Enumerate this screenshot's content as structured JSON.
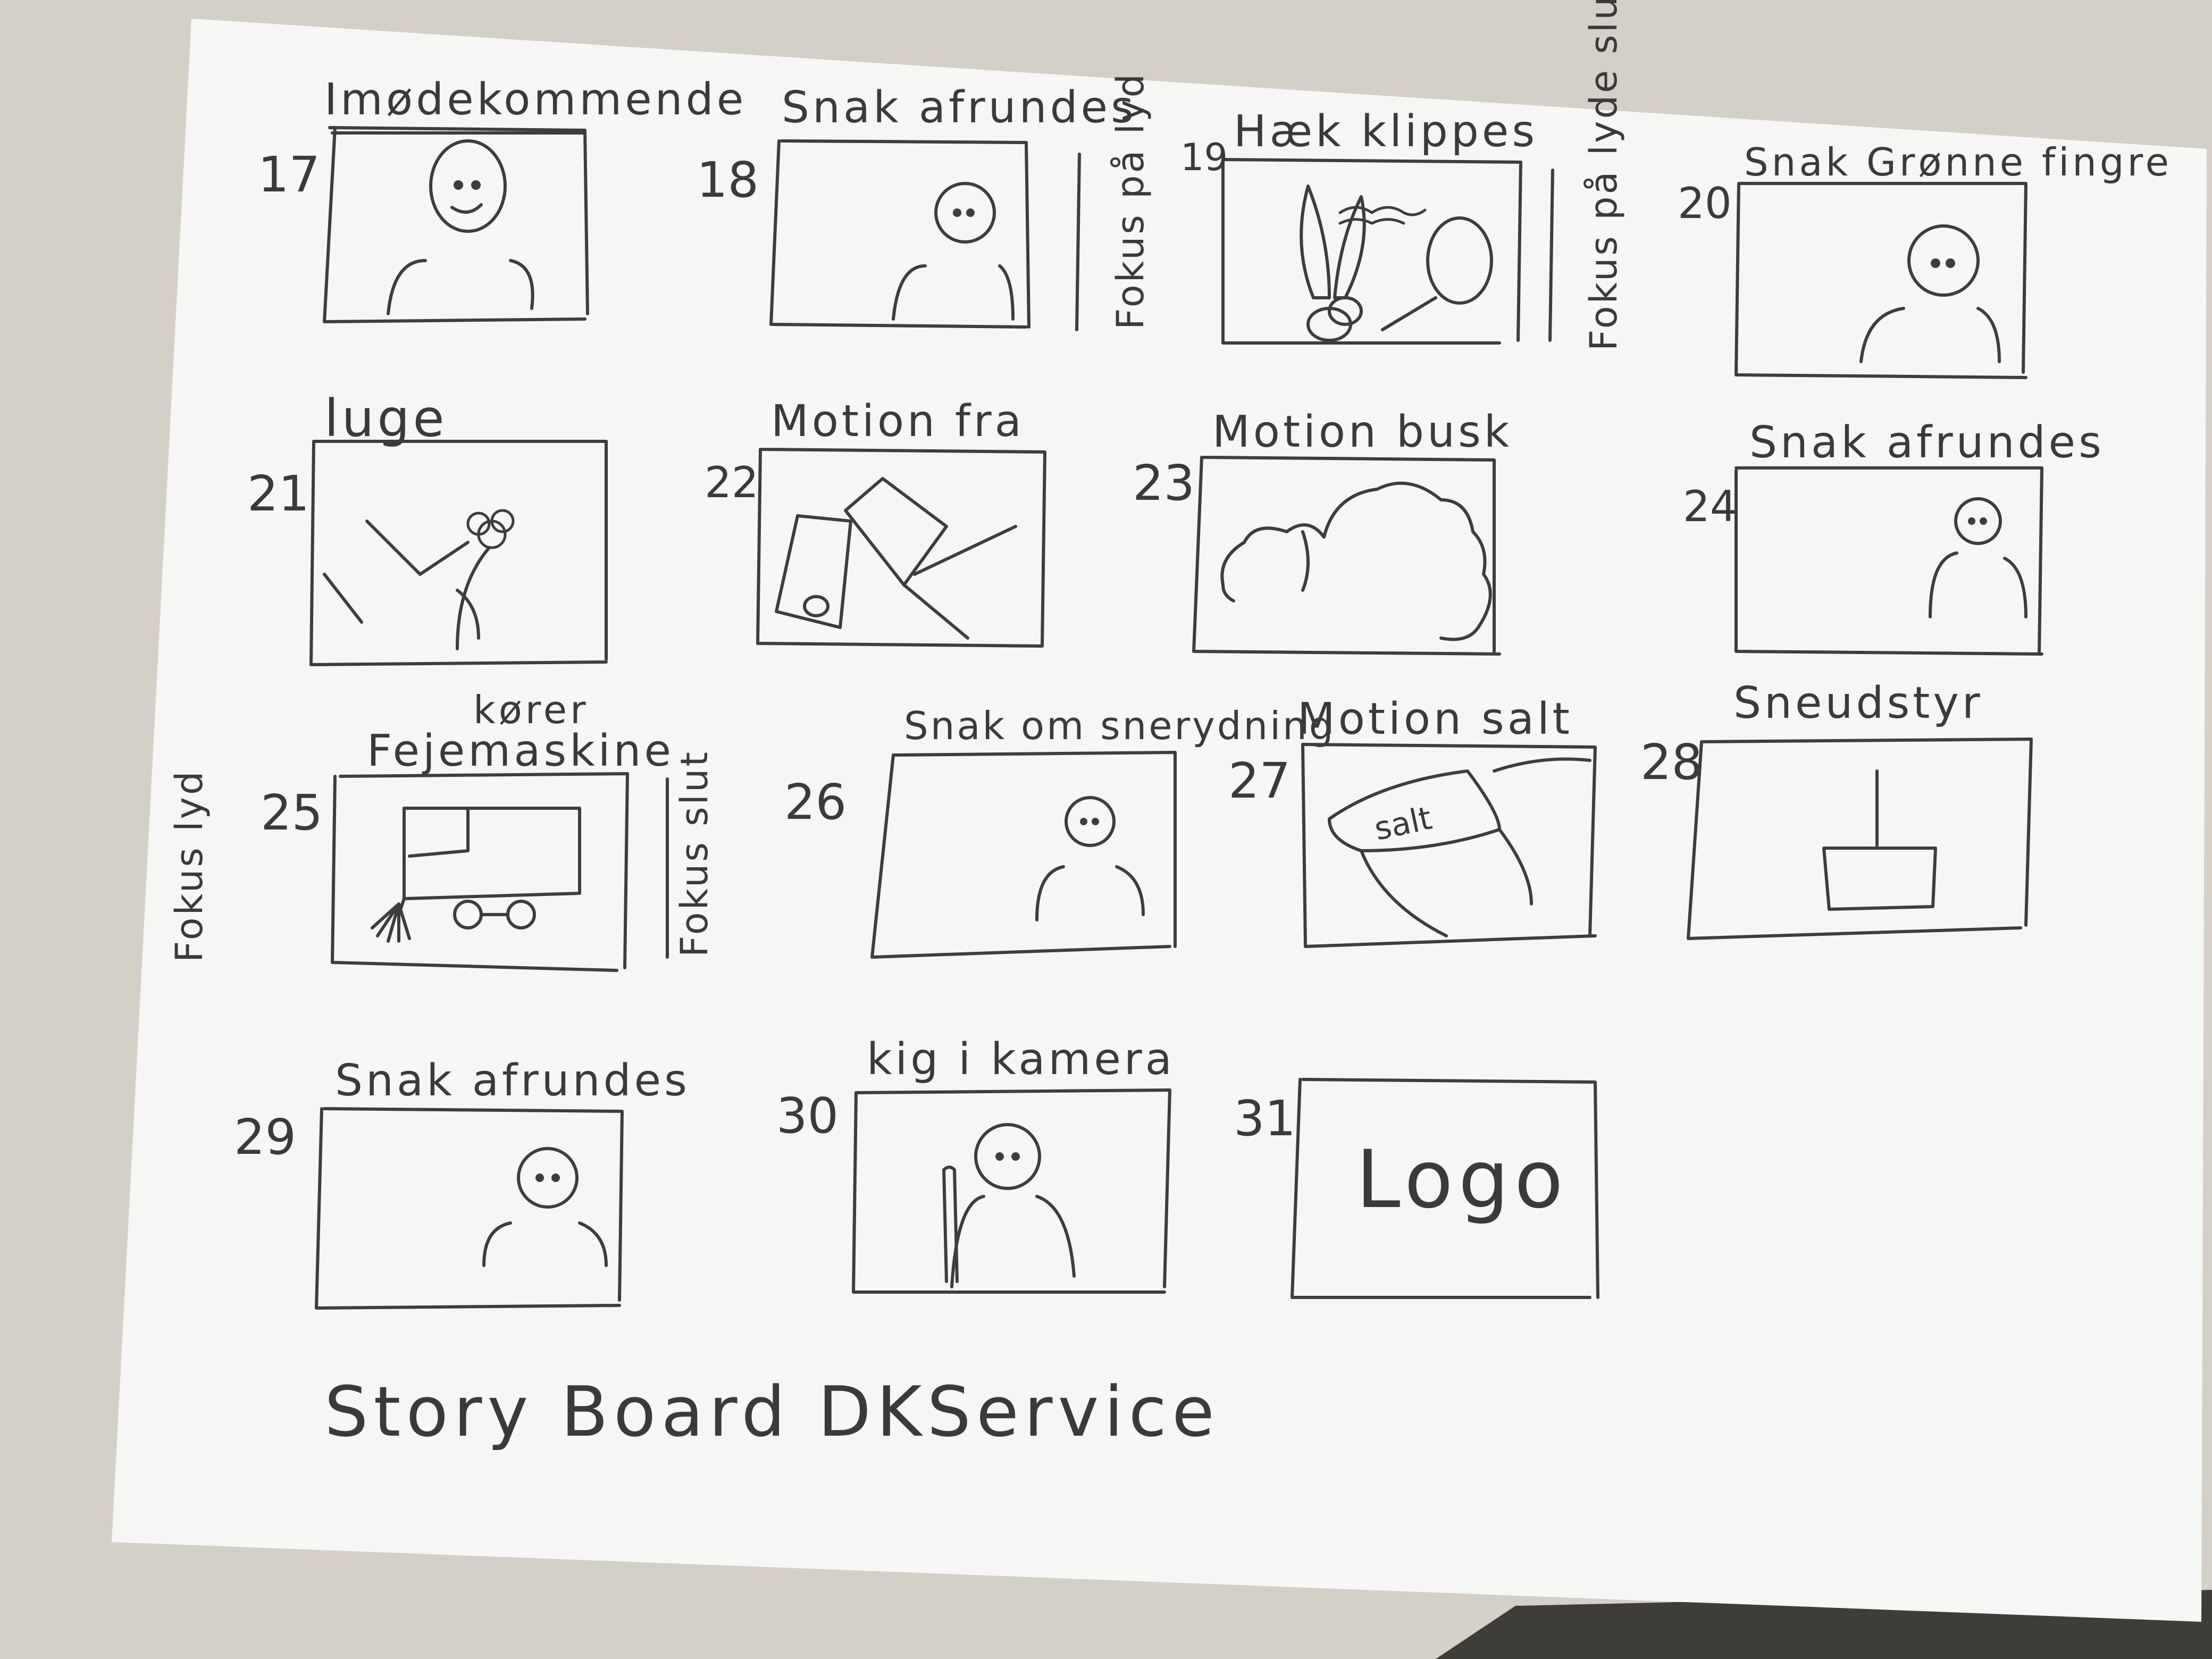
{
  "colors": {
    "paper": "#f6f6f4",
    "pencil": "#3d3d3d",
    "background_table": "#cfcbc2",
    "dark_corner": "#3f3d38"
  },
  "frames": [
    {
      "number": "17",
      "caption": "Imødekommende",
      "content": "person-smiling"
    },
    {
      "number": "18",
      "caption": "Snak afrundes",
      "content": "person"
    },
    {
      "number": "19",
      "caption": "Hæk klippes",
      "content": "hedge-shears"
    },
    {
      "number": "20",
      "caption": "Snak Grønne fingre",
      "content": "person"
    },
    {
      "number": "21",
      "caption": "luge",
      "content": "weeding-flower"
    },
    {
      "number": "22",
      "caption": "Motion fra",
      "content": "fr-sign"
    },
    {
      "number": "23",
      "caption": "Motion busk",
      "content": "bush"
    },
    {
      "number": "24",
      "caption": "Snak afrundes",
      "content": "person"
    },
    {
      "number": "25",
      "caption": "Fejemaskine",
      "caption_above": "kører",
      "content": "sweeper-machine"
    },
    {
      "number": "26",
      "caption": "Snak om snerydning",
      "content": "person"
    },
    {
      "number": "27",
      "caption": "Motion salt",
      "content": "salt-bag"
    },
    {
      "number": "28",
      "caption": "Sneudstyr",
      "content": "snow-shovel"
    },
    {
      "number": "29",
      "caption": "Snak afrundes",
      "content": "person"
    },
    {
      "number": "30",
      "caption": "kig i kamera",
      "content": "person-with-tool"
    },
    {
      "number": "31",
      "caption": "",
      "content": "logo",
      "logo_text": "Logo"
    }
  ],
  "side_notes": {
    "after_18": "Fokus på lyd",
    "after_19": "Fokus på lyde slut",
    "before_25": "Fokus lyd",
    "after_25": "Fokus slut"
  },
  "page_title": "Story Board DKService"
}
